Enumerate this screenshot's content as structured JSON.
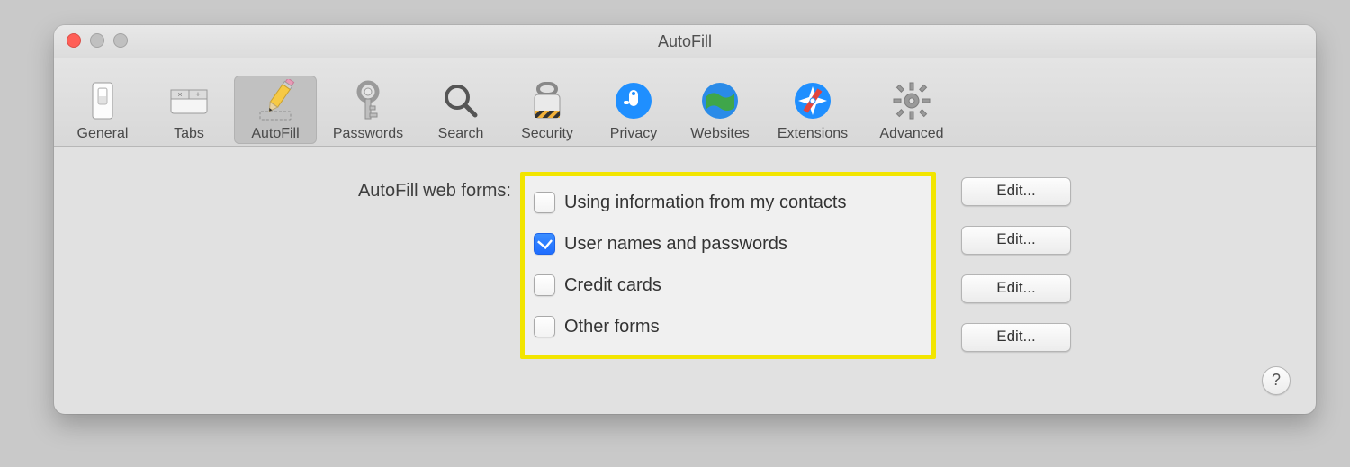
{
  "window_title": "AutoFill",
  "toolbar": [
    {
      "id": "general",
      "label": "General",
      "selected": false
    },
    {
      "id": "tabs",
      "label": "Tabs",
      "selected": false
    },
    {
      "id": "autofill",
      "label": "AutoFill",
      "selected": true
    },
    {
      "id": "passwords",
      "label": "Passwords",
      "selected": false
    },
    {
      "id": "search",
      "label": "Search",
      "selected": false
    },
    {
      "id": "security",
      "label": "Security",
      "selected": false
    },
    {
      "id": "privacy",
      "label": "Privacy",
      "selected": false
    },
    {
      "id": "websites",
      "label": "Websites",
      "selected": false
    },
    {
      "id": "extensions",
      "label": "Extensions",
      "selected": false
    },
    {
      "id": "advanced",
      "label": "Advanced",
      "selected": false
    }
  ],
  "section_label": "AutoFill web forms:",
  "options": [
    {
      "label": "Using information from my contacts",
      "checked": false,
      "edit": "Edit..."
    },
    {
      "label": "User names and passwords",
      "checked": true,
      "edit": "Edit..."
    },
    {
      "label": "Credit cards",
      "checked": false,
      "edit": "Edit..."
    },
    {
      "label": "Other forms",
      "checked": false,
      "edit": "Edit..."
    }
  ],
  "help_label": "?"
}
